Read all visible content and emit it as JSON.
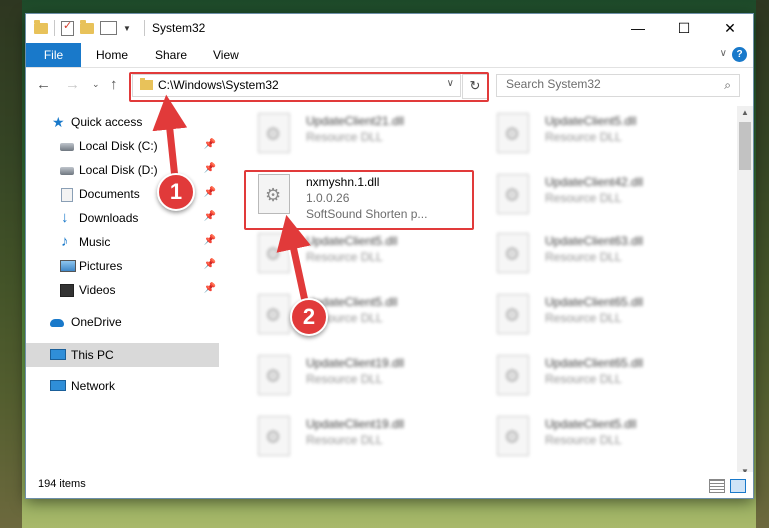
{
  "window": {
    "title": "System32"
  },
  "ribbon": {
    "file": "File",
    "home": "Home",
    "share": "Share",
    "view": "View"
  },
  "nav": {
    "address": "C:\\Windows\\System32",
    "search_placeholder": "Search System32"
  },
  "sidebar": {
    "items": [
      {
        "label": "Quick access",
        "icon": "star-icon"
      },
      {
        "label": "Local Disk (C:)",
        "icon": "drive-icon"
      },
      {
        "label": "Local Disk (D:)",
        "icon": "drive-icon"
      },
      {
        "label": "Documents",
        "icon": "documents-icon"
      },
      {
        "label": "Downloads",
        "icon": "download-icon"
      },
      {
        "label": "Music",
        "icon": "music-icon"
      },
      {
        "label": "Pictures",
        "icon": "pictures-icon"
      },
      {
        "label": "Videos",
        "icon": "videos-icon"
      },
      {
        "label": "OneDrive",
        "icon": "cloud-icon"
      },
      {
        "label": "This PC",
        "icon": "computer-icon"
      },
      {
        "label": "Network",
        "icon": "network-icon"
      }
    ]
  },
  "files": {
    "left": [
      {
        "name": "UpdateClient21.dll",
        "type": "Resource DLL"
      },
      {
        "name": "nxmyshn.1.dll",
        "version": "1.0.0.26",
        "description": "SoftSound Shorten p..."
      },
      {
        "name": "UpdateClient5.dll",
        "type": "Resource DLL"
      },
      {
        "name": "UpdateClient5.dll",
        "type": "Resource DLL"
      },
      {
        "name": "UpdateClient19.dll",
        "type": "Resource DLL"
      },
      {
        "name": "UpdateClient19.dll",
        "type": "Resource DLL"
      }
    ],
    "right": [
      {
        "name": "UpdateClient5.dll",
        "type": "Resource DLL"
      },
      {
        "name": "UpdateClient42.dll",
        "type": "Resource DLL"
      },
      {
        "name": "UpdateClient63.dll",
        "type": "Resource DLL"
      },
      {
        "name": "UpdateClient65.dll",
        "type": "Resource DLL"
      },
      {
        "name": "UpdateClient65.dll",
        "type": "Resource DLL"
      },
      {
        "name": "UpdateClient5.dll",
        "type": "Resource DLL"
      }
    ]
  },
  "status": {
    "count": "194 items"
  },
  "annotations": {
    "step1": "1",
    "step2": "2",
    "color": "#e13a3a"
  }
}
